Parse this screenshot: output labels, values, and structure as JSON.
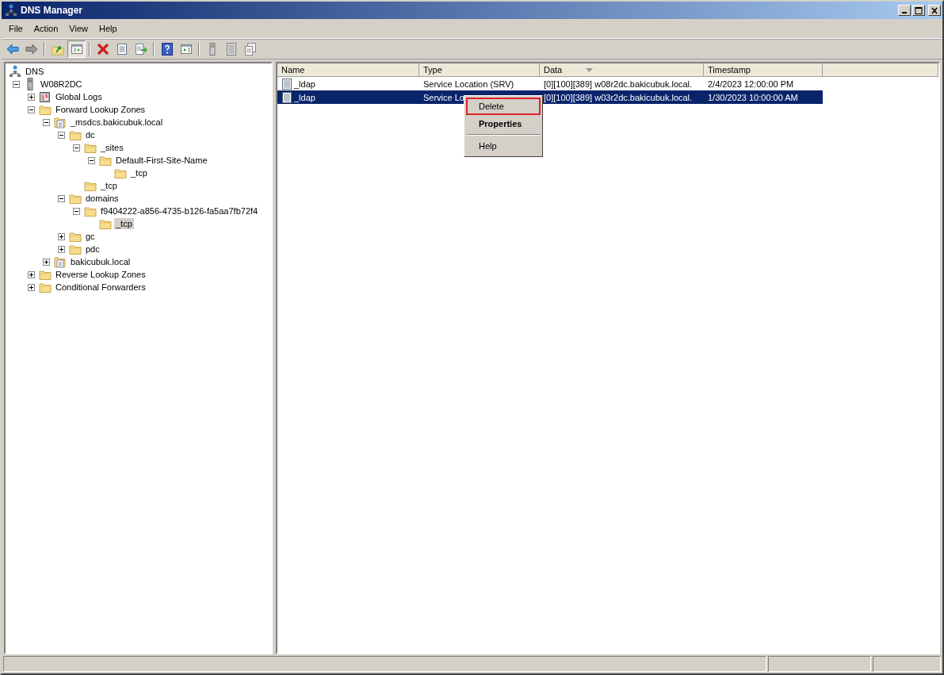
{
  "window": {
    "title": "DNS Manager"
  },
  "menu_bar": [
    "File",
    "Action",
    "View",
    "Help"
  ],
  "toolbar": [
    {
      "kind": "back",
      "pressed": false
    },
    {
      "kind": "forward",
      "pressed": false
    },
    {
      "kind": "sep"
    },
    {
      "kind": "up",
      "pressed": false
    },
    {
      "kind": "tree",
      "pressed": true
    },
    {
      "kind": "sep"
    },
    {
      "kind": "delete",
      "pressed": false
    },
    {
      "kind": "properties",
      "pressed": false
    },
    {
      "kind": "export",
      "pressed": false
    },
    {
      "kind": "sep"
    },
    {
      "kind": "help",
      "pressed": false
    },
    {
      "kind": "view",
      "pressed": false
    },
    {
      "kind": "sep"
    },
    {
      "kind": "server",
      "pressed": false
    },
    {
      "kind": "list",
      "pressed": false
    },
    {
      "kind": "copy",
      "pressed": false
    }
  ],
  "tree": {
    "label": "DNS",
    "kind": "dns",
    "selected": false,
    "children": [
      {
        "label": "W08R2DC",
        "kind": "server",
        "expanded": true,
        "selected": false,
        "children": [
          {
            "label": "Global Logs",
            "kind": "log",
            "expanded": false,
            "selected": false
          },
          {
            "label": "Forward Lookup Zones",
            "kind": "folder",
            "expanded": true,
            "selected": false,
            "children": [
              {
                "label": "_msdcs.bakicubuk.local",
                "kind": "zone",
                "expanded": true,
                "selected": false,
                "children": [
                  {
                    "label": "dc",
                    "kind": "folder",
                    "expanded": true,
                    "selected": false,
                    "children": [
                      {
                        "label": "_sites",
                        "kind": "folder",
                        "expanded": true,
                        "selected": false,
                        "children": [
                          {
                            "label": "Default-First-Site-Name",
                            "kind": "folder",
                            "expanded": true,
                            "selected": false,
                            "children": [
                              {
                                "label": "_tcp",
                                "kind": "folder",
                                "selected": false
                              }
                            ]
                          }
                        ]
                      },
                      {
                        "label": "_tcp",
                        "kind": "folder",
                        "selected": false
                      }
                    ]
                  },
                  {
                    "label": "domains",
                    "kind": "folder",
                    "expanded": true,
                    "selected": false,
                    "children": [
                      {
                        "label": "f9404222-a856-4735-b126-fa5aa7fb72f4",
                        "kind": "folder",
                        "expanded": true,
                        "selected": false,
                        "children": [
                          {
                            "label": "_tcp",
                            "kind": "folder",
                            "selected": true
                          }
                        ]
                      }
                    ]
                  },
                  {
                    "label": "gc",
                    "kind": "folder",
                    "expanded": false,
                    "selected": false
                  },
                  {
                    "label": "pdc",
                    "kind": "folder",
                    "expanded": false,
                    "selected": false
                  }
                ]
              },
              {
                "label": "bakicubuk.local",
                "kind": "zone",
                "expanded": false,
                "selected": false
              }
            ]
          },
          {
            "label": "Reverse Lookup Zones",
            "kind": "folder",
            "expanded": false,
            "selected": false
          },
          {
            "label": "Conditional Forwarders",
            "kind": "folder",
            "expanded": false,
            "selected": false
          }
        ]
      }
    ]
  },
  "table": {
    "columns": [
      {
        "label": "Name",
        "sorted": false
      },
      {
        "label": "Type",
        "sorted": false
      },
      {
        "label": "Data",
        "sorted": true
      },
      {
        "label": "Timestamp",
        "sorted": false
      }
    ],
    "rows": [
      {
        "name": "_ldap",
        "type": "Service Location (SRV)",
        "data": "[0][100][389] w08r2dc.bakicubuk.local.",
        "timestamp": "2/4/2023 12:00:00 PM",
        "selected": false
      },
      {
        "name": "_ldap",
        "type": "Service Lo",
        "data": "[0][100][389] w03r2dc.bakicubuk.local.",
        "timestamp": "1/30/2023 10:00:00 AM",
        "selected": true
      }
    ]
  },
  "context_menu": [
    {
      "kind": "item",
      "label": "Delete",
      "default": false,
      "highlighted": true
    },
    {
      "kind": "item",
      "label": "Properties",
      "default": true,
      "highlighted": false
    },
    {
      "kind": "separator"
    },
    {
      "kind": "item",
      "label": "Help",
      "default": false,
      "highlighted": false
    }
  ]
}
